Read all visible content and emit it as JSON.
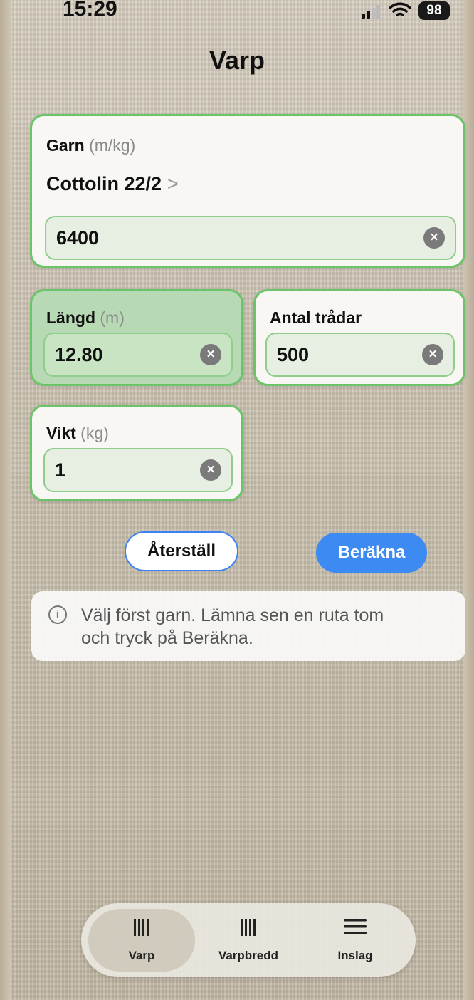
{
  "status_bar": {
    "time": "15:29",
    "battery": "98"
  },
  "title": "Varp",
  "yarn_card": {
    "label": "Garn",
    "unit": "(m/kg)",
    "yarn_name": "Cottolin 22/2",
    "chevron": ">",
    "value": "6400"
  },
  "length_card": {
    "label": "Längd",
    "unit": "(m)",
    "value": "12.80"
  },
  "threads_card": {
    "label": "Antal trådar",
    "value": "500"
  },
  "weight_card": {
    "label": "Vikt",
    "unit": "(kg)",
    "value": "1"
  },
  "buttons": {
    "reset": "Återställ",
    "calculate": "Beräkna"
  },
  "info": {
    "icon": "i",
    "text_line1": "Välj först garn. Lämna sen en ruta tom",
    "text_line2": "och tryck på Beräkna."
  },
  "clear_glyph": "×",
  "tabs": [
    {
      "label": "Varp",
      "icon": "warp-icon",
      "selected": true
    },
    {
      "label": "Varpbredd",
      "icon": "warp-width-icon",
      "selected": false
    },
    {
      "label": "Inslag",
      "icon": "weft-icon",
      "selected": false
    }
  ],
  "colors": {
    "accent_green": "#6cc46a",
    "active_green": "#b7d9b3",
    "blue": "#3d8bf2"
  }
}
